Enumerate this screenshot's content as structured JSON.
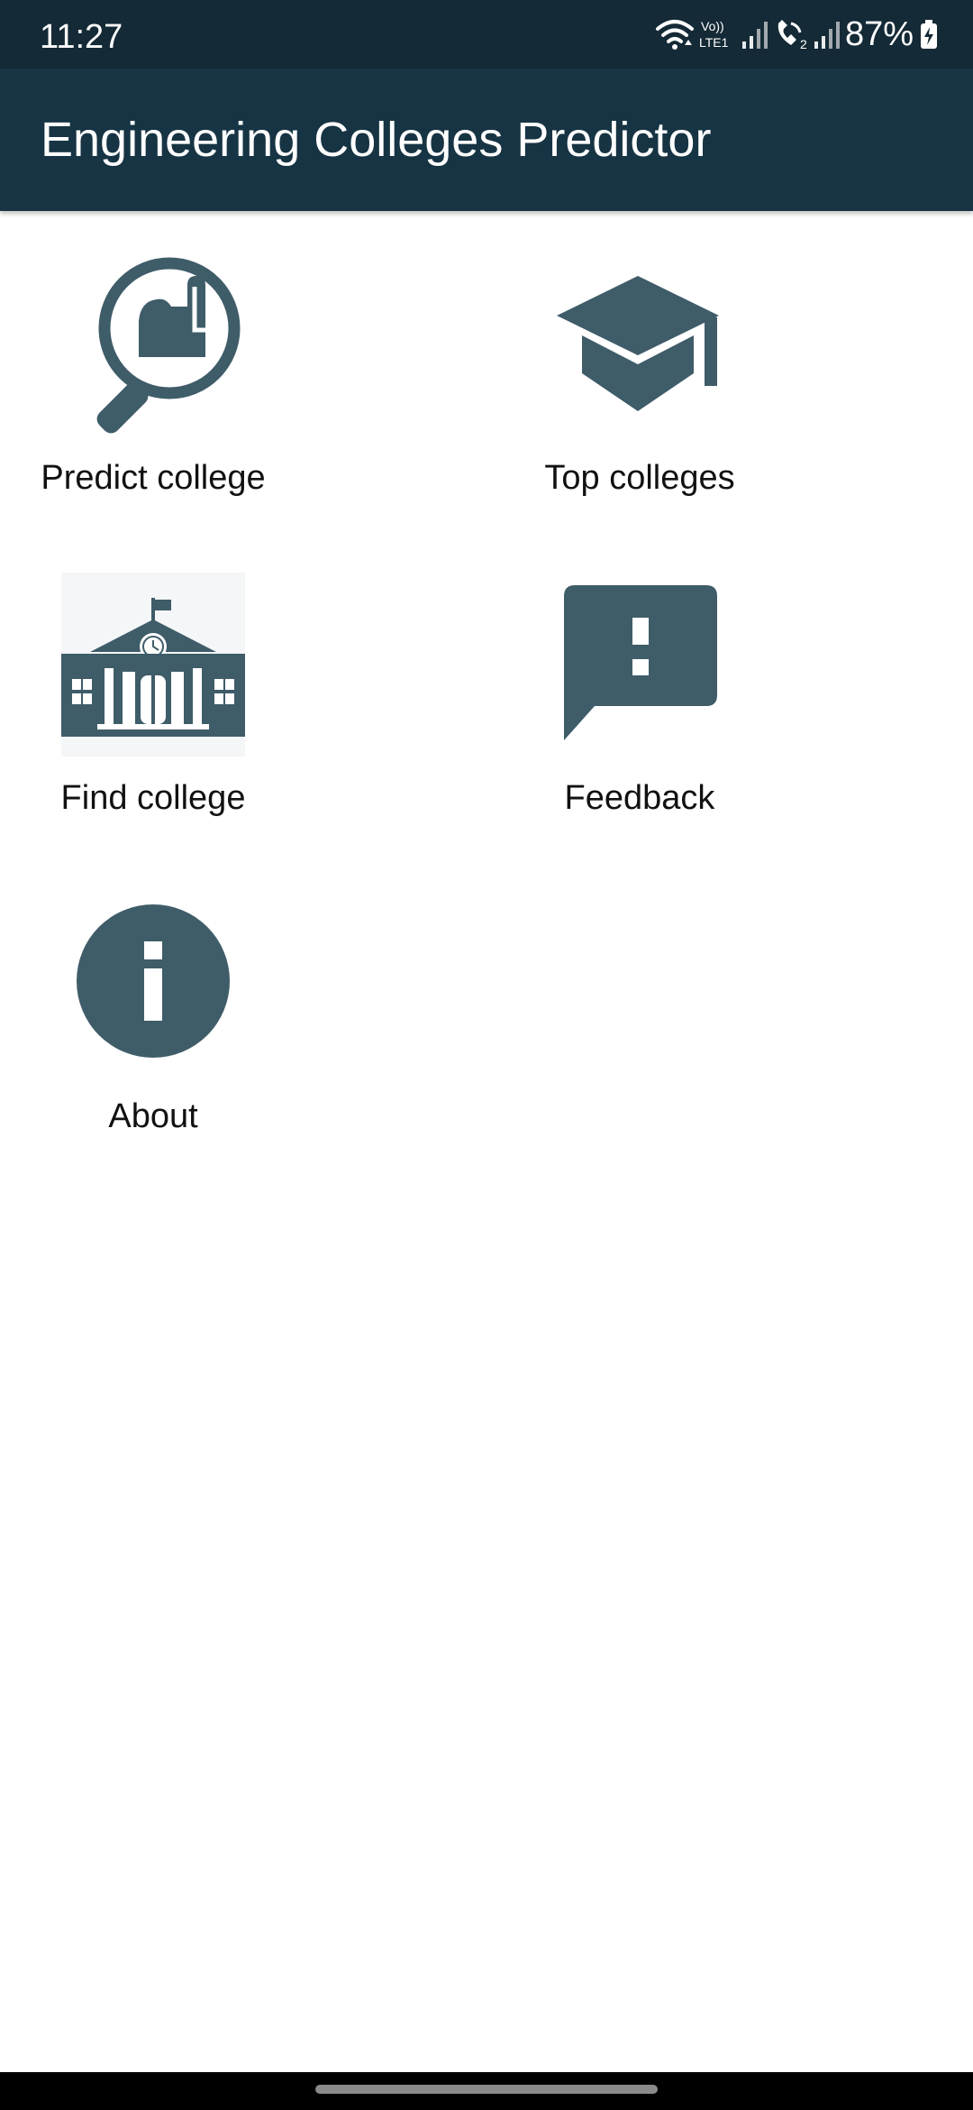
{
  "status_bar": {
    "time": "11:27",
    "battery": "87%",
    "network_label": "Vo)) LTE1",
    "sim_label": "2"
  },
  "app_bar": {
    "title": "Engineering Colleges Predictor"
  },
  "menu": {
    "items": [
      {
        "label": "Predict college",
        "icon": "search-hand-icon"
      },
      {
        "label": "Top colleges",
        "icon": "graduation-cap-icon"
      },
      {
        "label": "Find college",
        "icon": "college-building-icon"
      },
      {
        "label": "Feedback",
        "icon": "feedback-icon"
      },
      {
        "label": "About",
        "icon": "info-icon"
      }
    ]
  },
  "colors": {
    "status_bar_bg": "#142a36",
    "app_bar_bg": "#173444",
    "icon_color": "#3f5c69",
    "text_color": "#111111"
  }
}
